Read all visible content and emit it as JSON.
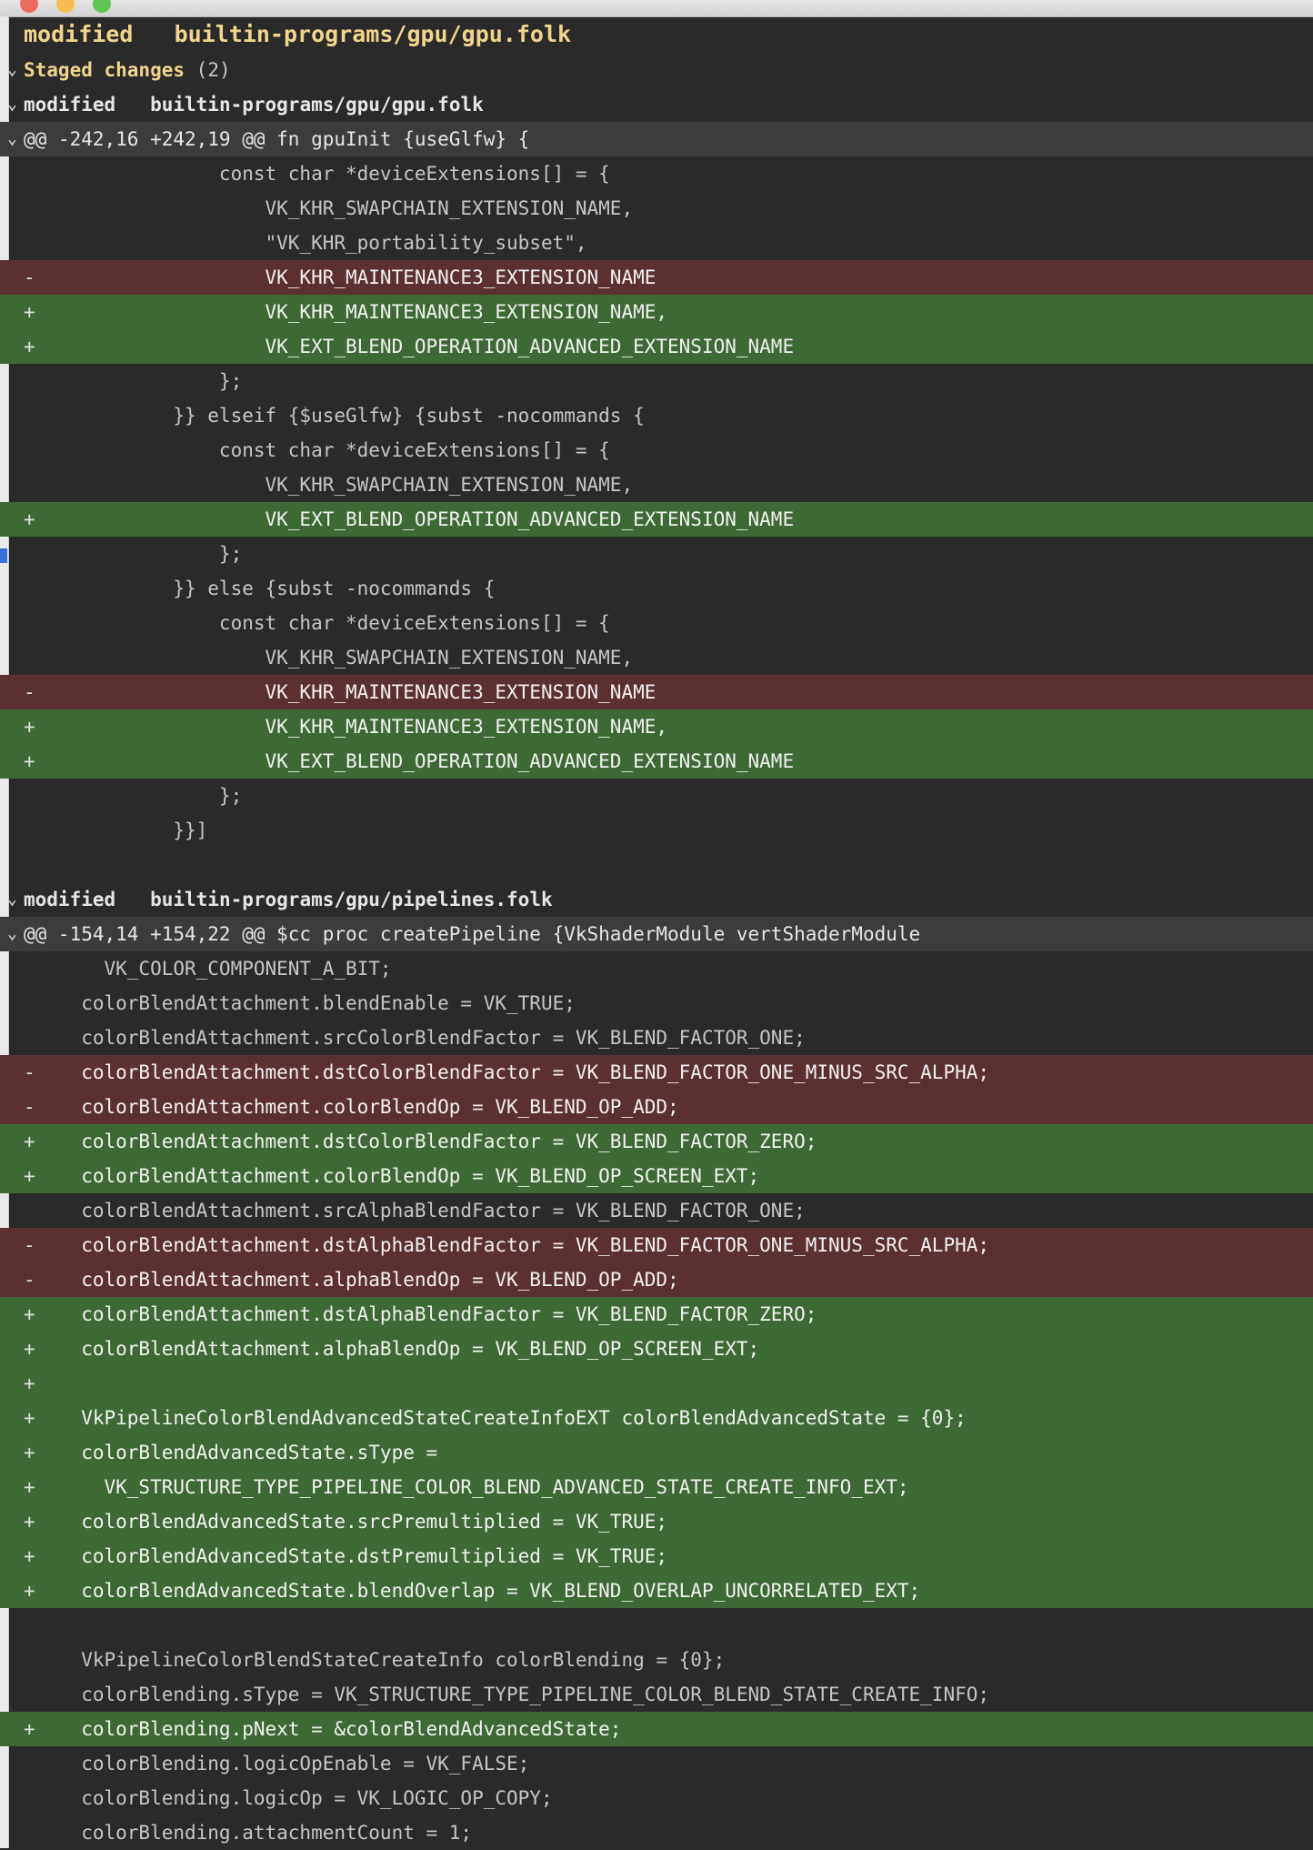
{
  "window": {
    "heading_label": "modified",
    "heading_path": "builtin-programs/gpu/gpu.folk"
  },
  "staged": {
    "label": "Staged changes",
    "count": "(2)"
  },
  "files": [
    {
      "label": "modified",
      "path": "builtin-programs/gpu/gpu.folk",
      "hunk": "@@ -242,16 +242,19 @@ fn gpuInit {useGlfw} {",
      "lines": [
        {
          "t": "ctx",
          "s": "",
          "c": "                 const char *deviceExtensions[] = {"
        },
        {
          "t": "ctx",
          "s": "",
          "c": "                     VK_KHR_SWAPCHAIN_EXTENSION_NAME,"
        },
        {
          "t": "ctx",
          "s": "",
          "c": "                     \"VK_KHR_portability_subset\","
        },
        {
          "t": "del",
          "s": "-",
          "c": "                     VK_KHR_MAINTENANCE3_EXTENSION_NAME"
        },
        {
          "t": "add",
          "s": "+",
          "c": "                     VK_KHR_MAINTENANCE3_EXTENSION_NAME,"
        },
        {
          "t": "add",
          "s": "+",
          "c": "                     VK_EXT_BLEND_OPERATION_ADVANCED_EXTENSION_NAME"
        },
        {
          "t": "ctx",
          "s": "",
          "c": "                 };"
        },
        {
          "t": "ctx",
          "s": "",
          "c": "             }} elseif {$useGlfw} {subst -nocommands {"
        },
        {
          "t": "ctx",
          "s": "",
          "c": "                 const char *deviceExtensions[] = {"
        },
        {
          "t": "ctx",
          "s": "",
          "c": "                     VK_KHR_SWAPCHAIN_EXTENSION_NAME,"
        },
        {
          "t": "add",
          "s": "+",
          "c": "                     VK_EXT_BLEND_OPERATION_ADVANCED_EXTENSION_NAME"
        },
        {
          "t": "ctx",
          "s": "",
          "c": "                 };"
        },
        {
          "t": "ctx",
          "s": "",
          "c": "             }} else {subst -nocommands {"
        },
        {
          "t": "ctx",
          "s": "",
          "c": "                 const char *deviceExtensions[] = {"
        },
        {
          "t": "ctx",
          "s": "",
          "c": "                     VK_KHR_SWAPCHAIN_EXTENSION_NAME,"
        },
        {
          "t": "del",
          "s": "-",
          "c": "                     VK_KHR_MAINTENANCE3_EXTENSION_NAME"
        },
        {
          "t": "add",
          "s": "+",
          "c": "                     VK_KHR_MAINTENANCE3_EXTENSION_NAME,"
        },
        {
          "t": "add",
          "s": "+",
          "c": "                     VK_EXT_BLEND_OPERATION_ADVANCED_EXTENSION_NAME"
        },
        {
          "t": "ctx",
          "s": "",
          "c": "                 };"
        },
        {
          "t": "ctx",
          "s": "",
          "c": "             }}]"
        },
        {
          "t": "blank",
          "s": "",
          "c": ""
        }
      ]
    },
    {
      "label": "modified",
      "path": "builtin-programs/gpu/pipelines.folk",
      "hunk": "@@ -154,14 +154,22 @@ $cc proc createPipeline {VkShaderModule vertShaderModule",
      "lines": [
        {
          "t": "ctx",
          "s": "",
          "c": "       VK_COLOR_COMPONENT_A_BIT;"
        },
        {
          "t": "ctx",
          "s": "",
          "c": "     colorBlendAttachment.blendEnable = VK_TRUE;"
        },
        {
          "t": "ctx",
          "s": "",
          "c": "     colorBlendAttachment.srcColorBlendFactor = VK_BLEND_FACTOR_ONE;"
        },
        {
          "t": "del",
          "s": "-",
          "c": "     colorBlendAttachment.dstColorBlendFactor = VK_BLEND_FACTOR_ONE_MINUS_SRC_ALPHA;"
        },
        {
          "t": "del",
          "s": "-",
          "c": "     colorBlendAttachment.colorBlendOp = VK_BLEND_OP_ADD;"
        },
        {
          "t": "add",
          "s": "+",
          "c": "     colorBlendAttachment.dstColorBlendFactor = VK_BLEND_FACTOR_ZERO;"
        },
        {
          "t": "add",
          "s": "+",
          "c": "     colorBlendAttachment.colorBlendOp = VK_BLEND_OP_SCREEN_EXT;"
        },
        {
          "t": "ctx",
          "s": "",
          "c": "     colorBlendAttachment.srcAlphaBlendFactor = VK_BLEND_FACTOR_ONE;"
        },
        {
          "t": "del",
          "s": "-",
          "c": "     colorBlendAttachment.dstAlphaBlendFactor = VK_BLEND_FACTOR_ONE_MINUS_SRC_ALPHA;"
        },
        {
          "t": "del",
          "s": "-",
          "c": "     colorBlendAttachment.alphaBlendOp = VK_BLEND_OP_ADD;"
        },
        {
          "t": "add",
          "s": "+",
          "c": "     colorBlendAttachment.dstAlphaBlendFactor = VK_BLEND_FACTOR_ZERO;"
        },
        {
          "t": "add",
          "s": "+",
          "c": "     colorBlendAttachment.alphaBlendOp = VK_BLEND_OP_SCREEN_EXT;"
        },
        {
          "t": "add",
          "s": "+",
          "c": ""
        },
        {
          "t": "add",
          "s": "+",
          "c": "     VkPipelineColorBlendAdvancedStateCreateInfoEXT colorBlendAdvancedState = {0};"
        },
        {
          "t": "add",
          "s": "+",
          "c": "     colorBlendAdvancedState.sType ="
        },
        {
          "t": "add",
          "s": "+",
          "c": "       VK_STRUCTURE_TYPE_PIPELINE_COLOR_BLEND_ADVANCED_STATE_CREATE_INFO_EXT;"
        },
        {
          "t": "add",
          "s": "+",
          "c": "     colorBlendAdvancedState.srcPremultiplied = VK_TRUE;"
        },
        {
          "t": "add",
          "s": "+",
          "c": "     colorBlendAdvancedState.dstPremultiplied = VK_TRUE;"
        },
        {
          "t": "add",
          "s": "+",
          "c": "     colorBlendAdvancedState.blendOverlap = VK_BLEND_OVERLAP_UNCORRELATED_EXT;"
        },
        {
          "t": "blank",
          "s": "",
          "c": ""
        },
        {
          "t": "ctx",
          "s": "",
          "c": "     VkPipelineColorBlendStateCreateInfo colorBlending = {0};"
        },
        {
          "t": "ctx",
          "s": "",
          "c": "     colorBlending.sType = VK_STRUCTURE_TYPE_PIPELINE_COLOR_BLEND_STATE_CREATE_INFO;"
        },
        {
          "t": "add",
          "s": "+",
          "c": "     colorBlending.pNext = &colorBlendAdvancedState;"
        },
        {
          "t": "ctx",
          "s": "",
          "c": "     colorBlending.logicOpEnable = VK_FALSE;"
        },
        {
          "t": "ctx",
          "s": "",
          "c": "     colorBlending.logicOp = VK_LOGIC_OP_COPY;"
        },
        {
          "t": "ctx",
          "s": "",
          "c": "     colorBlending.attachmentCount = 1;"
        }
      ]
    }
  ],
  "colors": {
    "background": "#2a2a2a",
    "added": "#3e6835",
    "removed": "#5b3030",
    "hunk": "#3c3c3c",
    "heading": "#f0d58c"
  },
  "icons": {
    "section_toggle": "chevron-down-icon",
    "close": "window-close-button",
    "minimize": "window-minimize-button",
    "zoom": "window-zoom-button"
  }
}
